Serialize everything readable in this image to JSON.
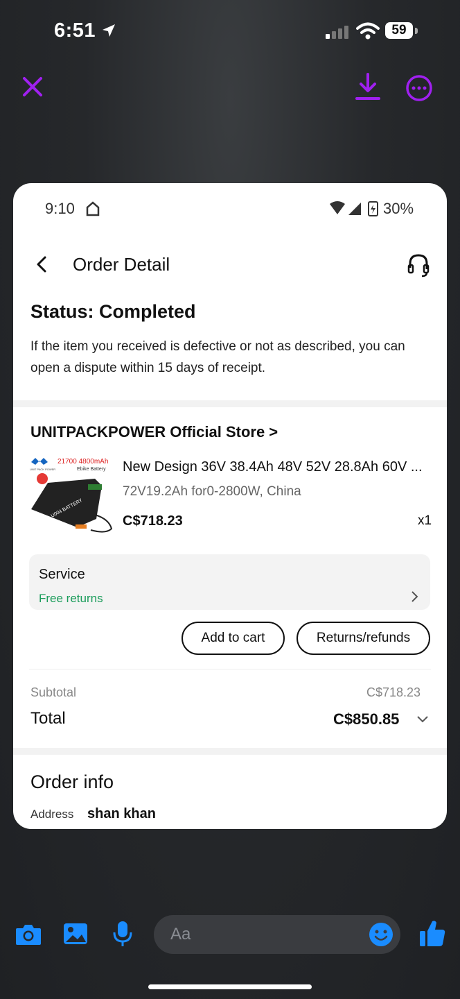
{
  "ios_status": {
    "time": "6:51",
    "battery": "59"
  },
  "inner_status": {
    "time": "9:10",
    "battery": "30%"
  },
  "header": {
    "title": "Order Detail"
  },
  "order": {
    "status": "Status: Completed",
    "description": "If the item you received is defective or not as described, you can open a dispute within 15 days of receipt."
  },
  "store": {
    "name": "UNITPACKPOWER Official Store >"
  },
  "product": {
    "title_line1": "New Design 36V 38.4Ah 48V 52V 28.8Ah 60V ...",
    "title_line2": "72V19.2Ah for0-2800W, China",
    "price": "C$718.23",
    "qty": "x1",
    "image_text": {
      "spec": "21700 4800mAh",
      "sub": "Ebike Battery",
      "brand": "UNIT PACK POWER",
      "label": "U004 BATTERY"
    }
  },
  "service": {
    "label": "Service",
    "value": "Free returns"
  },
  "actions": {
    "add_to_cart": "Add to cart",
    "returns": "Returns/refunds"
  },
  "summary": {
    "subtotal_label": "Subtotal",
    "subtotal_value": "C$718.23",
    "total_label": "Total",
    "total_value": "C$850.85"
  },
  "order_info": {
    "title": "Order info",
    "address_label": "Address",
    "address_value": "shan khan"
  },
  "composer": {
    "placeholder": "Aa"
  },
  "colors": {
    "accent_purple": "#a020f0",
    "messenger_blue": "#1a8cff",
    "free_green": "#1a9c5a"
  },
  "icons": [
    "close-icon",
    "download-icon",
    "more-icon",
    "back-icon",
    "headset-icon",
    "chevron-right-icon",
    "chevron-down-icon",
    "camera-icon",
    "gallery-icon",
    "microphone-icon",
    "emoji-icon",
    "thumbs-up-icon"
  ]
}
